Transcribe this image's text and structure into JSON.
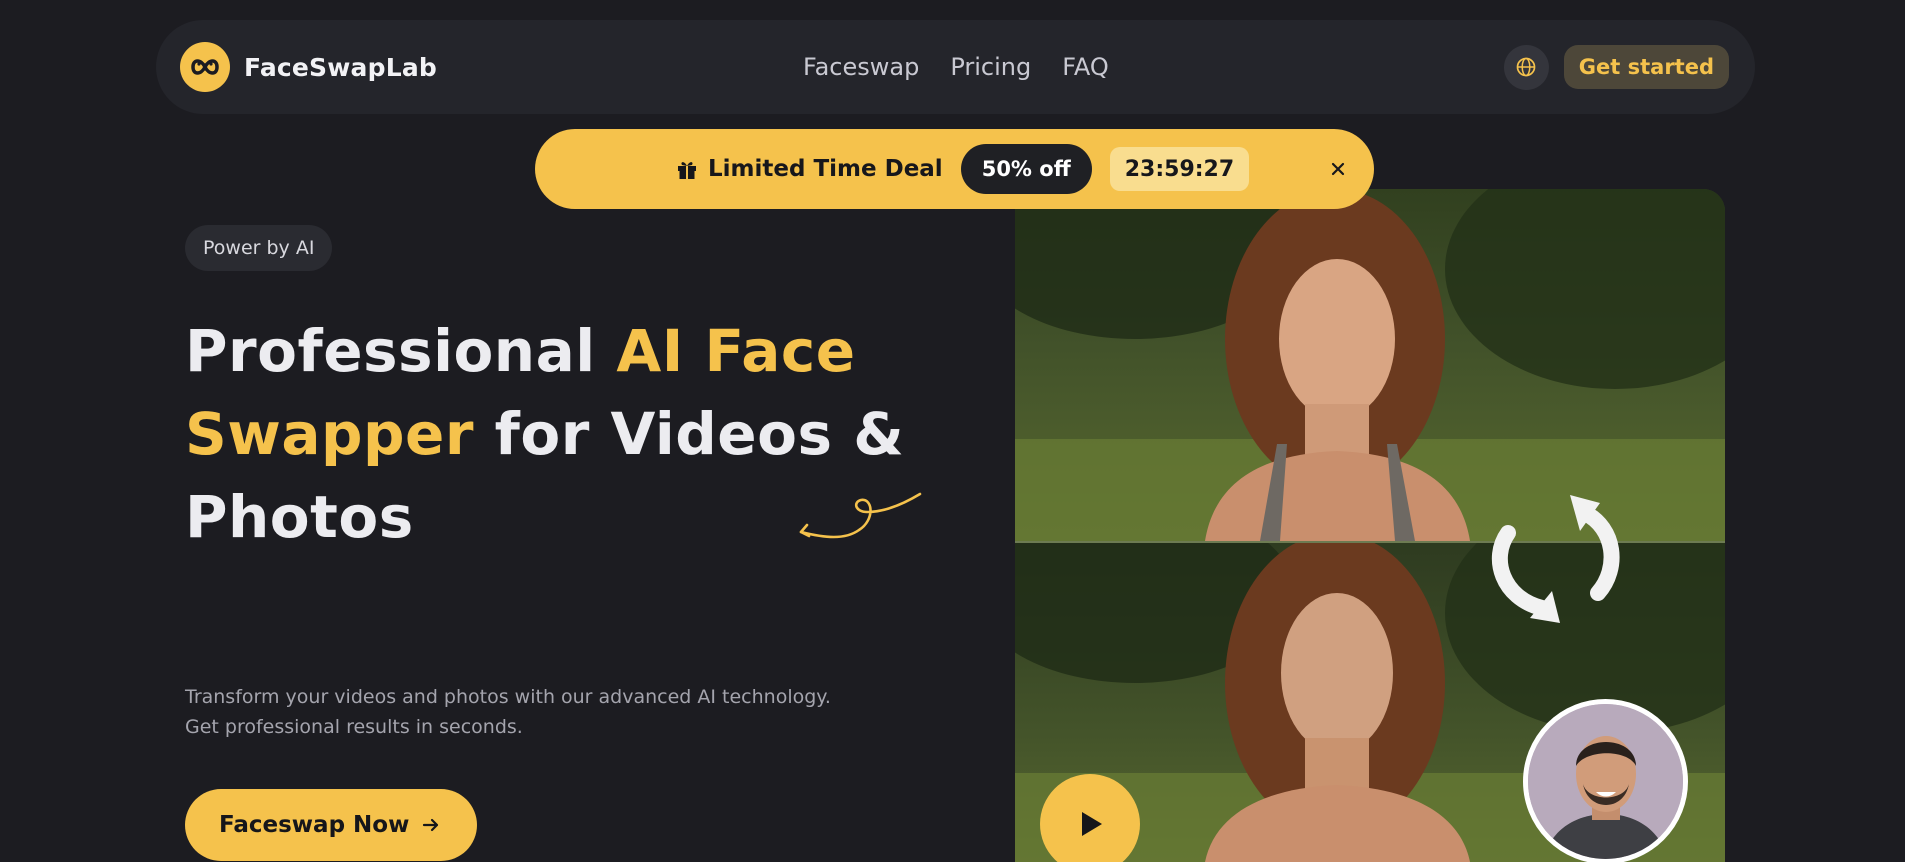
{
  "brand": {
    "name": "FaceSwapLab",
    "accent": "#f5c24c"
  },
  "nav": {
    "links": [
      "Faceswap",
      "Pricing",
      "FAQ"
    ],
    "language_icon": "globe-icon",
    "cta_label": "Get started"
  },
  "deal": {
    "icon": "gift-icon",
    "title": "Limited Time Deal",
    "badge": "50% off",
    "countdown": "23:59:27",
    "close_icon": "close-icon"
  },
  "hero": {
    "pill": "Power by AI",
    "headline": {
      "part1": "Professional ",
      "highlight": "AI Face Swapper",
      "part2": " for Videos & Photos"
    },
    "description_line1": "Transform your videos and photos with our advanced AI technology.",
    "description_line2": "Get professional results in seconds.",
    "primary_button": "Faceswap Now",
    "primary_button_icon": "arrow-right-icon"
  },
  "visual": {
    "play_icon": "play-icon",
    "swap_icon": "swap-arrows-icon"
  }
}
